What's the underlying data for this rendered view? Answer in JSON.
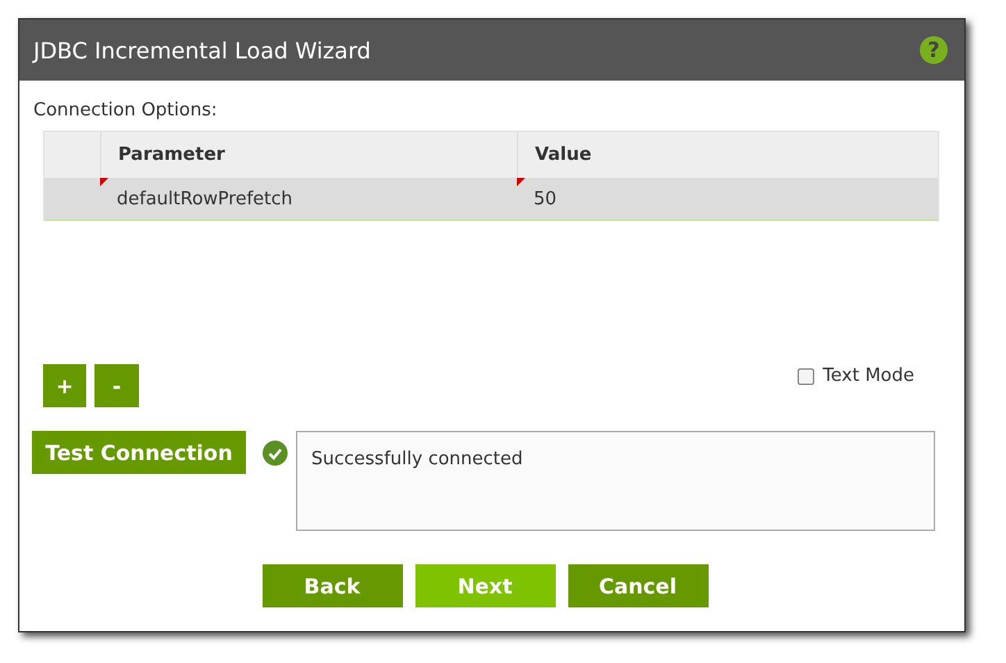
{
  "window": {
    "title": "JDBC Incremental Load Wizard",
    "help_icon": "?"
  },
  "connection_options": {
    "label": "Connection Options:",
    "columns": [
      "Parameter",
      "Value"
    ],
    "rows": [
      {
        "parameter": "defaultRowPrefetch",
        "value": "50",
        "selected": true
      }
    ]
  },
  "row_buttons": [
    "+",
    "-"
  ],
  "text_mode": {
    "label": "Text Mode",
    "checked": false
  },
  "test": {
    "button": "Test Connection",
    "success": true,
    "result": "Successfully connected"
  },
  "buttons": [
    {
      "label": "Back",
      "highlighted": false
    },
    {
      "label": "Next",
      "highlighted": true
    },
    {
      "label": "Cancel",
      "highlighted": false
    }
  ]
}
